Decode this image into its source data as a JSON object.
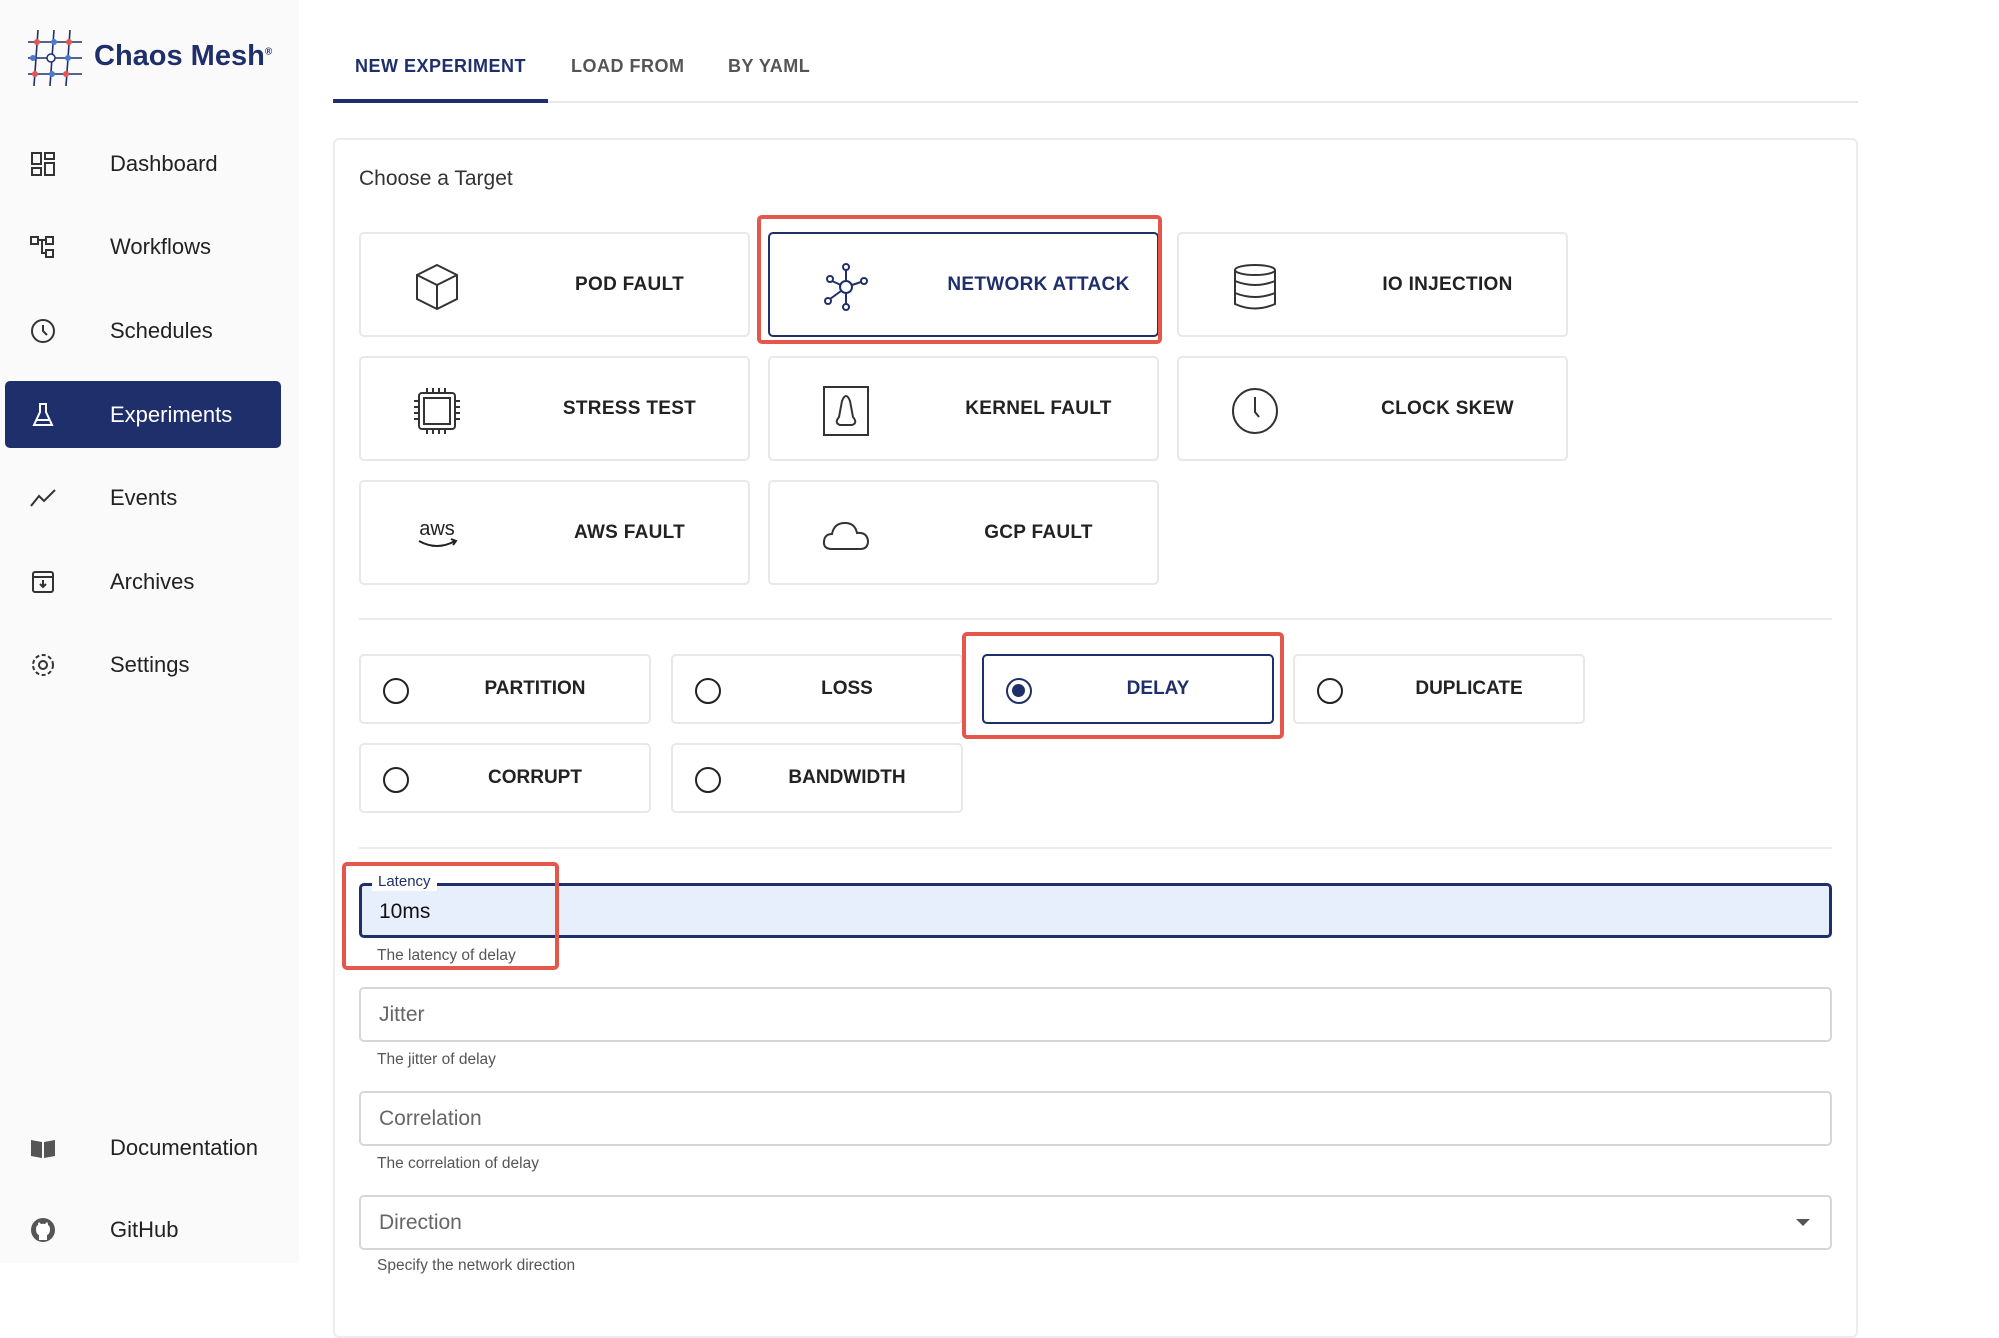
{
  "brand": {
    "name": "Chaos Mesh",
    "mark": "®"
  },
  "sidebar": {
    "items": [
      {
        "label": "Dashboard",
        "icon": "dashboard-icon"
      },
      {
        "label": "Workflows",
        "icon": "workflow-icon"
      },
      {
        "label": "Schedules",
        "icon": "clock-icon"
      },
      {
        "label": "Experiments",
        "icon": "flask-icon",
        "active": true
      },
      {
        "label": "Events",
        "icon": "trend-icon"
      },
      {
        "label": "Archives",
        "icon": "archive-icon"
      },
      {
        "label": "Settings",
        "icon": "gear-icon"
      }
    ],
    "bottom": [
      {
        "label": "Documentation",
        "icon": "book-icon"
      },
      {
        "label": "GitHub",
        "icon": "github-icon"
      }
    ]
  },
  "tabs": [
    {
      "label": "NEW EXPERIMENT",
      "active": true
    },
    {
      "label": "LOAD FROM"
    },
    {
      "label": "BY YAML"
    }
  ],
  "main": {
    "heading": "Choose a Target",
    "targets": [
      {
        "label": "POD FAULT",
        "icon": "cube-icon"
      },
      {
        "label": "NETWORK ATTACK",
        "icon": "network-icon",
        "selected": true
      },
      {
        "label": "IO INJECTION",
        "icon": "database-icon"
      },
      {
        "label": "STRESS TEST",
        "icon": "cpu-icon"
      },
      {
        "label": "KERNEL FAULT",
        "icon": "linux-icon"
      },
      {
        "label": "CLOCK SKEW",
        "icon": "clock-icon"
      },
      {
        "label": "AWS FAULT",
        "icon": "aws-icon"
      },
      {
        "label": "GCP FAULT",
        "icon": "cloud-icon"
      }
    ],
    "actions": [
      {
        "label": "PARTITION"
      },
      {
        "label": "LOSS"
      },
      {
        "label": "DELAY",
        "selected": true
      },
      {
        "label": "DUPLICATE"
      },
      {
        "label": "CORRUPT"
      },
      {
        "label": "BANDWIDTH"
      }
    ],
    "fields": {
      "latency": {
        "label": "Latency",
        "value": "10ms",
        "helper": "The latency of delay"
      },
      "jitter": {
        "placeholder": "Jitter",
        "helper": "The jitter of delay"
      },
      "correlation": {
        "placeholder": "Correlation",
        "helper": "The correlation of delay"
      },
      "direction": {
        "placeholder": "Direction",
        "helper": "Specify the network direction"
      }
    }
  },
  "colors": {
    "primary": "#1f2f6b",
    "highlight": "#e5574b",
    "focus_fill": "#e8effc"
  }
}
